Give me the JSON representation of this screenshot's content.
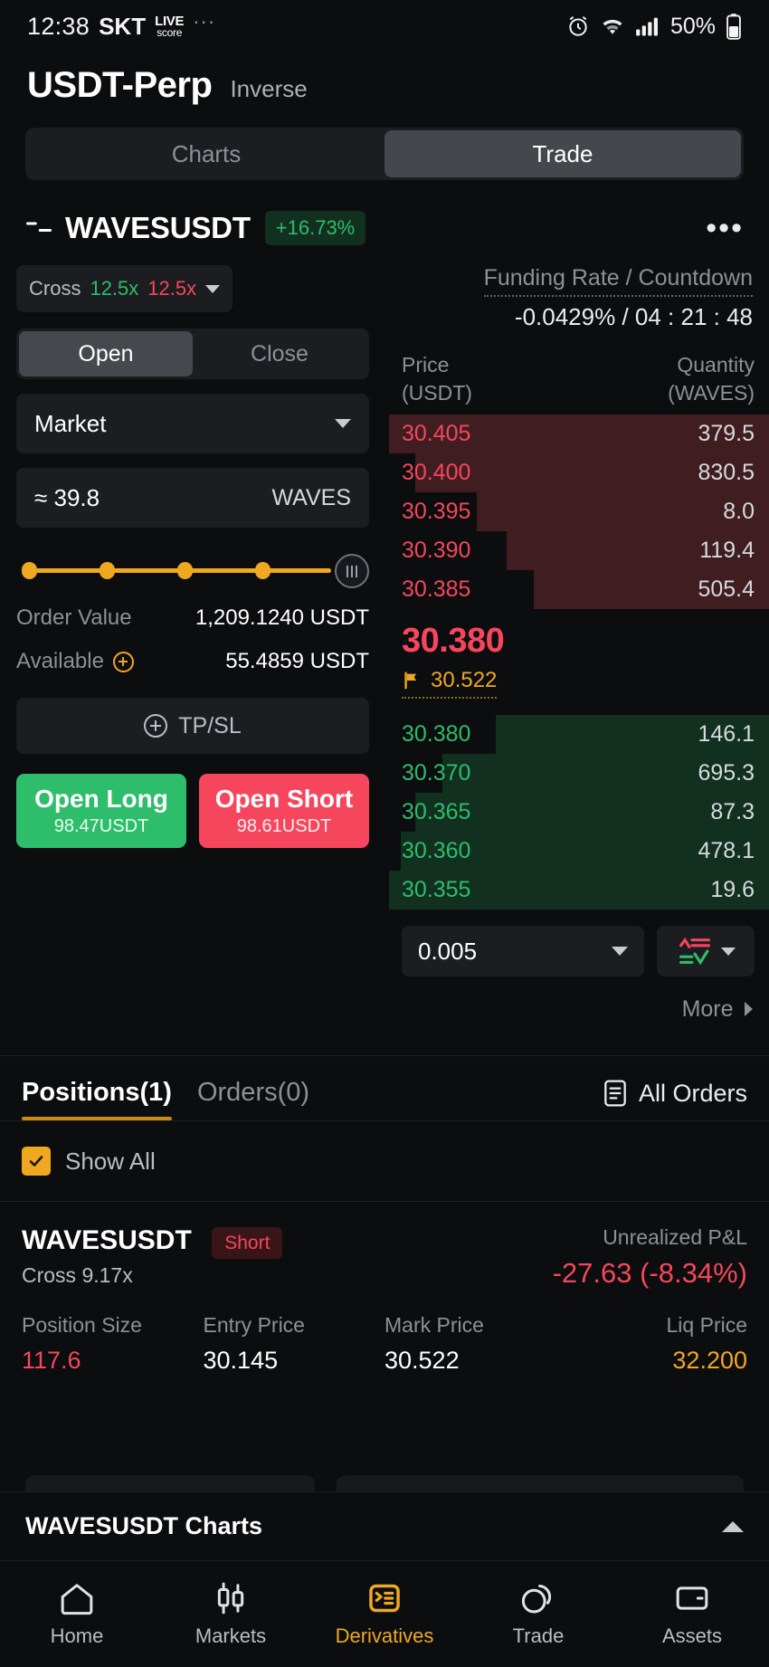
{
  "status_bar": {
    "time": "12:38",
    "carrier": "SKT",
    "live_top": "LIVE",
    "live_bottom": "score",
    "overflow": "···",
    "battery_percent": "50%",
    "alarm_icon": "alarm-icon",
    "wifi_icon": "wifi-icon",
    "signal_icon": "signal-icon",
    "battery_icon": "battery-icon"
  },
  "header": {
    "title": "USDT-Perp",
    "subtitle": "Inverse",
    "tabs": [
      {
        "label": "Charts",
        "active": false
      },
      {
        "label": "Trade",
        "active": true
      }
    ]
  },
  "symbol": {
    "icon": "chart-lines-icon",
    "name": "WAVESUSDT",
    "change": "+16.73%",
    "change_color": "#2ebd6b",
    "more_icon": "more-horizontal-icon"
  },
  "order_form": {
    "leverage": {
      "mode": "Cross",
      "long_value": "12.5x",
      "short_value": "12.5x",
      "long_color": "#2ebd6b",
      "short_color": "#f6465d",
      "caret_icon": "chevron-down-icon"
    },
    "open_close": [
      {
        "label": "Open",
        "active": true
      },
      {
        "label": "Close",
        "active": false
      }
    ],
    "order_type": {
      "value": "Market",
      "caret_icon": "chevron-down-icon"
    },
    "quantity": {
      "value": "≈ 39.8",
      "unit": "WAVES"
    },
    "slider": {
      "stops": 5,
      "handle_icon": "slider-handle-icon"
    },
    "order_value": {
      "label": "Order Value",
      "value": "1,209.1240 USDT"
    },
    "available": {
      "label": "Available",
      "value": "55.4859 USDT",
      "icon": "plus-circle-icon"
    },
    "tpsl": {
      "label": "TP/SL",
      "icon": "plus-circle-icon"
    },
    "buttons": [
      {
        "label": "Open Long",
        "sub": "98.47USDT",
        "color": "#2ebd6b"
      },
      {
        "label": "Open Short",
        "sub": "98.61USDT",
        "color": "#f6465d"
      }
    ]
  },
  "funding": {
    "label": "Funding Rate / Countdown",
    "value": "-0.0429% / 04 : 21 : 48"
  },
  "orderbook": {
    "price_header": "Price",
    "price_unit": "(USDT)",
    "qty_header": "Quantity",
    "qty_unit": "(WAVES)",
    "asks": [
      {
        "price": "30.405",
        "qty": "379.5",
        "depth": 100
      },
      {
        "price": "30.400",
        "qty": "830.5",
        "depth": 93
      },
      {
        "price": "30.395",
        "qty": "8.0",
        "depth": 77
      },
      {
        "price": "30.390",
        "qty": "119.4",
        "depth": 69
      },
      {
        "price": "30.385",
        "qty": "505.4",
        "depth": 62
      }
    ],
    "mid": {
      "last_price": "30.380",
      "last_color": "#f6465d",
      "mark_icon": "flag-icon",
      "mark_price": "30.522",
      "mark_color": "#f0a821"
    },
    "bids": [
      {
        "price": "30.380",
        "qty": "146.1",
        "depth": 72
      },
      {
        "price": "30.370",
        "qty": "695.3",
        "depth": 86
      },
      {
        "price": "30.365",
        "qty": "87.3",
        "depth": 93
      },
      {
        "price": "30.360",
        "qty": "478.1",
        "depth": 97
      },
      {
        "price": "30.355",
        "qty": "19.6",
        "depth": 100
      }
    ],
    "tick_size": "0.005",
    "tick_caret_icon": "chevron-down-icon",
    "depth_view_icon": "depth-view-icon",
    "depth_caret_icon": "chevron-down-icon",
    "more_label": "More",
    "more_icon": "chevron-right-icon",
    "ask_bar_color": "#401d21",
    "bid_bar_color": "#11301f"
  },
  "positions_section": {
    "tabs": [
      {
        "label": "Positions(1)",
        "active": true
      },
      {
        "label": "Orders(0)",
        "active": false
      }
    ],
    "all_orders": {
      "label": "All Orders",
      "icon": "list-document-icon"
    },
    "show_all": {
      "label": "Show All",
      "checked": true,
      "icon": "checkmark-icon"
    },
    "position": {
      "symbol": "WAVESUSDT",
      "side": "Short",
      "leverage": "Cross 9.17x",
      "pnl_label": "Unrealized P&L",
      "pnl_value": "-27.63 (-8.34%)",
      "metrics": [
        {
          "label": "Position Size",
          "value": "117.6"
        },
        {
          "label": "Entry Price",
          "value": "30.145"
        },
        {
          "label": "Mark Price",
          "value": "30.522"
        },
        {
          "label": "Liq Price",
          "value": "32.200"
        }
      ]
    }
  },
  "charts_bar": {
    "title": "WAVESUSDT Charts",
    "collapse_icon": "chevron-up-icon"
  },
  "bottom_nav": [
    {
      "label": "Home",
      "icon": "home-icon",
      "active": false
    },
    {
      "label": "Markets",
      "icon": "candlestick-icon",
      "active": false
    },
    {
      "label": "Derivatives",
      "icon": "derivatives-icon",
      "active": true
    },
    {
      "label": "Trade",
      "icon": "trade-swap-icon",
      "active": false
    },
    {
      "label": "Assets",
      "icon": "wallet-icon",
      "active": false
    }
  ]
}
